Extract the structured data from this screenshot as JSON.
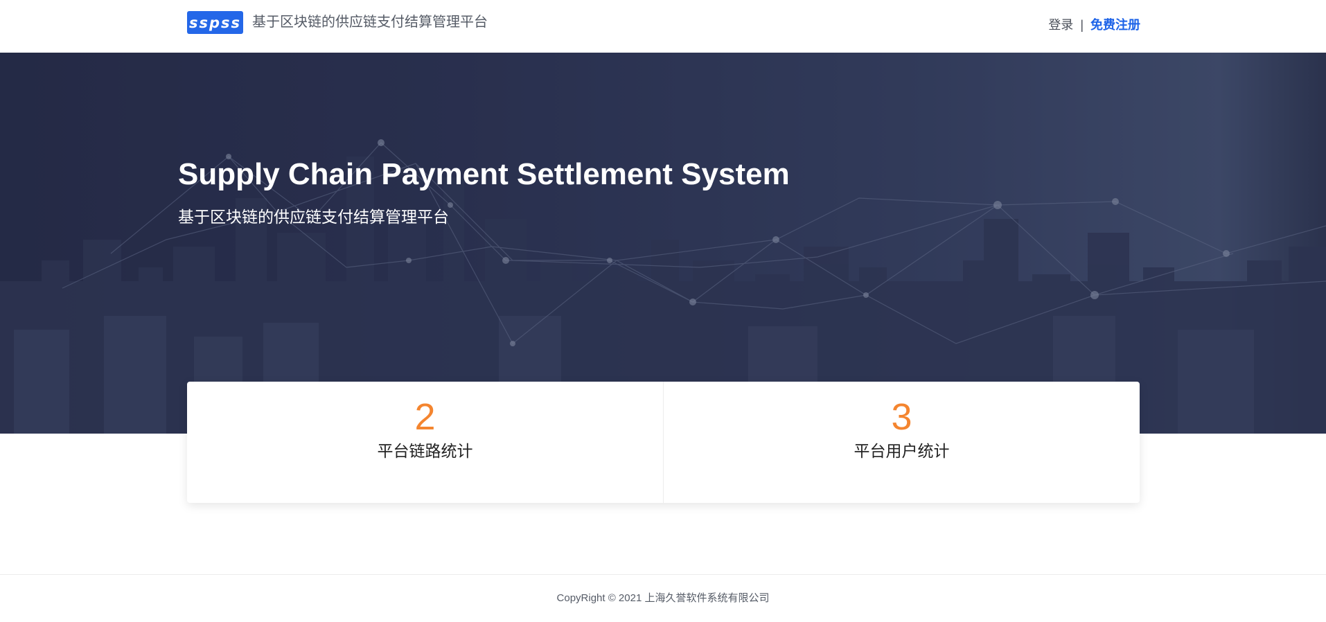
{
  "header": {
    "logo_text": "sspss",
    "site_title": "基于区块链的供应链支付结算管理平台",
    "login_label": "登录",
    "separator": "|",
    "register_label": "免费注册"
  },
  "hero": {
    "title": "Supply Chain Payment Settlement System",
    "subtitle": "基于区块链的供应链支付结算管理平台"
  },
  "stats": [
    {
      "value": "2",
      "label": "平台链路统计"
    },
    {
      "value": "3",
      "label": "平台用户统计"
    }
  ],
  "footer": {
    "copyright": "CopyRight © 2021 上海久誉软件系统有限公司"
  },
  "colors": {
    "brand_blue": "#2467e8",
    "register_blue": "#1d63e8",
    "stat_orange": "#f4852f",
    "hero_dark": "#2a304d"
  }
}
